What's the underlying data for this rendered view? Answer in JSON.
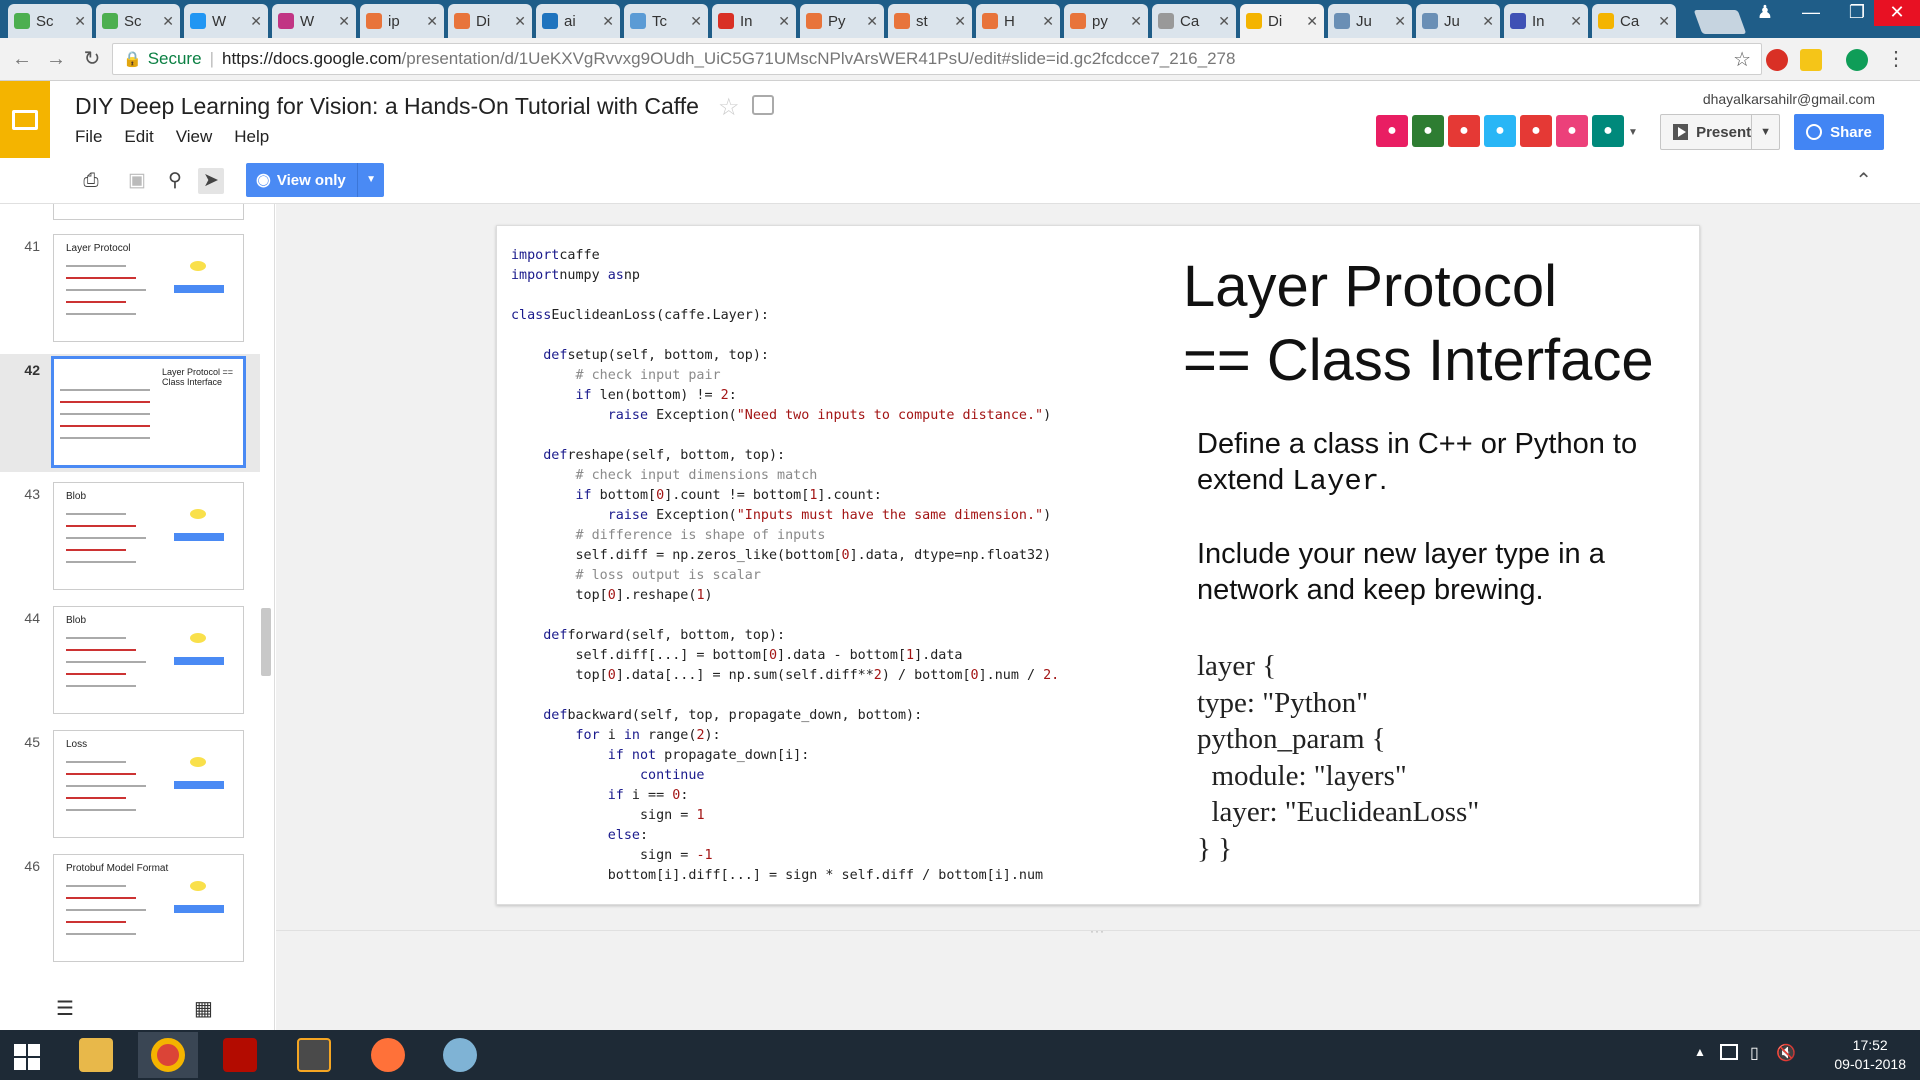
{
  "browser": {
    "tabs": [
      {
        "title": "Sc",
        "color": "#4caf50"
      },
      {
        "title": "Sc",
        "color": "#4caf50"
      },
      {
        "title": "W",
        "color": "#2196f3"
      },
      {
        "title": "W",
        "color": "#c13584"
      },
      {
        "title": "ip",
        "color": "#e8743b"
      },
      {
        "title": "Di",
        "color": "#e8743b"
      },
      {
        "title": "ai",
        "color": "#1e73be"
      },
      {
        "title": "Tc",
        "color": "#5b9bd5"
      },
      {
        "title": "In",
        "color": "#d93025"
      },
      {
        "title": "Py",
        "color": "#e8743b"
      },
      {
        "title": "st",
        "color": "#e8743b"
      },
      {
        "title": "H",
        "color": "#e8743b"
      },
      {
        "title": "py",
        "color": "#e8743b"
      },
      {
        "title": "Ca",
        "color": "#999999"
      },
      {
        "title": "Di",
        "color": "#f4b400"
      },
      {
        "title": "Ju",
        "color": "#6a8fb5"
      },
      {
        "title": "Ju",
        "color": "#6a8fb5"
      },
      {
        "title": "In",
        "color": "#3f51b5"
      },
      {
        "title": "Ca",
        "color": "#f4b400"
      }
    ],
    "secure_label": "Secure",
    "url_host": "https://docs.google.com",
    "url_path": "/presentation/d/1UeKXVgRvvxg9OUdh_UiC5G71UMscNPlvArsWER41PsU/edit#slide=id.gc2fcdcce7_216_278"
  },
  "docs": {
    "title": "DIY Deep Learning for Vision:  a Hands-On Tutorial with Caffe",
    "menus": [
      "File",
      "Edit",
      "View",
      "Help"
    ],
    "email": "dhayalkarsahilr@gmail.com",
    "present_label": "Present",
    "share_label": "Share",
    "view_only_label": "View only",
    "addon_colors": [
      "#e91e63",
      "#2e7d32",
      "#e53935",
      "#29b6f6",
      "#e53935",
      "#ec407a",
      "#00897b"
    ]
  },
  "filmstrip": [
    {
      "num": "41",
      "title": "Layer Protocol"
    },
    {
      "num": "42",
      "title": "Layer Protocol == Class Interface"
    },
    {
      "num": "43",
      "title": "Blob"
    },
    {
      "num": "44",
      "title": "Blob"
    },
    {
      "num": "45",
      "title": "Loss"
    },
    {
      "num": "46",
      "title": "Protobuf Model Format"
    }
  ],
  "slide": {
    "title_line1": "Layer Protocol",
    "title_line2": "== Class Interface",
    "body1_pre": "Define a class in C++ or Python to extend ",
    "body1_code": "Layer",
    "body1_post": ".",
    "body2": "Include your new layer type in a network and keep brewing.",
    "proto": "layer {\ntype: \"Python\"\npython_param {\n  module: \"layers\"\n  layer: \"EuclideanLoss\"\n} }",
    "code_lines": [
      [
        [
          "kw",
          "import"
        ],
        [
          "",
          "caffe"
        ]
      ],
      [
        [
          "kw",
          "import"
        ],
        [
          "",
          "numpy "
        ],
        [
          "kw",
          "as"
        ],
        [
          "",
          "np"
        ]
      ],
      [],
      [
        [
          "kw",
          "class"
        ],
        [
          "",
          "EuclideanLoss(caffe.Layer):"
        ]
      ],
      [],
      [
        [
          "",
          "    "
        ],
        [
          "kw",
          "def"
        ],
        [
          "",
          "setup(self, bottom, top):"
        ]
      ],
      [
        [
          "cm",
          "        # check input pair"
        ]
      ],
      [
        [
          "",
          "        "
        ],
        [
          "kw",
          "if"
        ],
        [
          "",
          " len(bottom) != "
        ],
        [
          "nm",
          "2"
        ],
        [
          "",
          ":"
        ]
      ],
      [
        [
          "",
          "            "
        ],
        [
          "kw",
          "raise"
        ],
        [
          "",
          " Exception("
        ],
        [
          "st",
          "\"Need two inputs to compute distance.\""
        ],
        [
          "",
          ")"
        ]
      ],
      [],
      [
        [
          "",
          "    "
        ],
        [
          "kw",
          "def"
        ],
        [
          "",
          "reshape(self, bottom, top):"
        ]
      ],
      [
        [
          "cm",
          "        # check input dimensions match"
        ]
      ],
      [
        [
          "",
          "        "
        ],
        [
          "kw",
          "if"
        ],
        [
          "",
          " bottom["
        ],
        [
          "nm",
          "0"
        ],
        [
          "",
          "].count != bottom["
        ],
        [
          "nm",
          "1"
        ],
        [
          "",
          "].count:"
        ]
      ],
      [
        [
          "",
          "            "
        ],
        [
          "kw",
          "raise"
        ],
        [
          "",
          " Exception("
        ],
        [
          "st",
          "\"Inputs must have the same dimension.\""
        ],
        [
          "",
          ")"
        ]
      ],
      [
        [
          "cm",
          "        # difference is shape of inputs"
        ]
      ],
      [
        [
          "",
          "        self.diff = np.zeros_like(bottom["
        ],
        [
          "nm",
          "0"
        ],
        [
          "",
          "].data, dtype=np.float32)"
        ]
      ],
      [
        [
          "cm",
          "        # loss output is scalar"
        ]
      ],
      [
        [
          "",
          "        top["
        ],
        [
          "nm",
          "0"
        ],
        [
          "",
          "].reshape("
        ],
        [
          "nm",
          "1"
        ],
        [
          "",
          ")"
        ]
      ],
      [],
      [
        [
          "",
          "    "
        ],
        [
          "kw",
          "def"
        ],
        [
          "",
          "forward(self, bottom, top):"
        ]
      ],
      [
        [
          "",
          "        self.diff[...] = bottom["
        ],
        [
          "nm",
          "0"
        ],
        [
          "",
          "].data - bottom["
        ],
        [
          "nm",
          "1"
        ],
        [
          "",
          "].data"
        ]
      ],
      [
        [
          "",
          "        top["
        ],
        [
          "nm",
          "0"
        ],
        [
          "",
          "].data[...] = np.sum(self.diff**"
        ],
        [
          "nm",
          "2"
        ],
        [
          "",
          ") / bottom["
        ],
        [
          "nm",
          "0"
        ],
        [
          "",
          "].num / "
        ],
        [
          "nm",
          "2."
        ]
      ],
      [],
      [
        [
          "",
          "    "
        ],
        [
          "kw",
          "def"
        ],
        [
          "",
          "backward(self, top, propagate_down, bottom):"
        ]
      ],
      [
        [
          "",
          "        "
        ],
        [
          "kw",
          "for"
        ],
        [
          "",
          " i "
        ],
        [
          "kw",
          "in"
        ],
        [
          "",
          " range("
        ],
        [
          "nm",
          "2"
        ],
        [
          "",
          "):"
        ]
      ],
      [
        [
          "",
          "            "
        ],
        [
          "kw",
          "if not"
        ],
        [
          "",
          " propagate_down[i]:"
        ]
      ],
      [
        [
          "",
          "                "
        ],
        [
          "kw",
          "continue"
        ]
      ],
      [
        [
          "",
          "            "
        ],
        [
          "kw",
          "if"
        ],
        [
          "",
          " i == "
        ],
        [
          "nm",
          "0"
        ],
        [
          "",
          ":"
        ]
      ],
      [
        [
          "",
          "                sign = "
        ],
        [
          "nm",
          "1"
        ]
      ],
      [
        [
          "",
          "            "
        ],
        [
          "kw",
          "else"
        ],
        [
          "",
          ":"
        ]
      ],
      [
        [
          "",
          "                sign = "
        ],
        [
          "nm",
          "-1"
        ]
      ],
      [
        [
          "",
          "            bottom[i].diff[...] = sign * self.diff / bottom[i].num"
        ]
      ]
    ]
  },
  "taskbar": {
    "time": "17:52",
    "date": "09-01-2018"
  }
}
